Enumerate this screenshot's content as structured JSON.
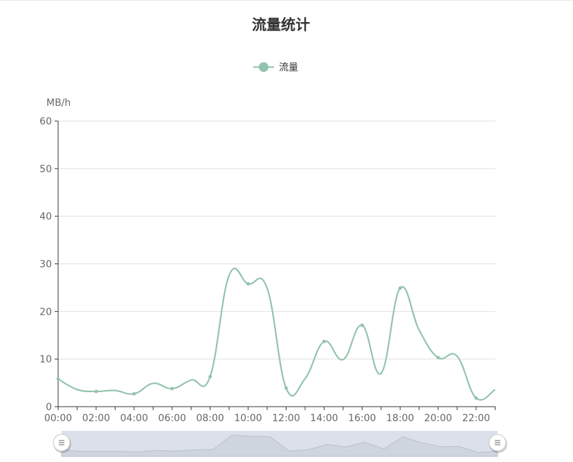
{
  "chart_data": {
    "type": "line",
    "title": "流量统计",
    "ylabel": "MB/h",
    "xlabel": "",
    "legend": {
      "position": "top-center",
      "entries": [
        "流量"
      ]
    },
    "series": [
      {
        "name": "流量",
        "color": "#93c3ac",
        "smooth": true,
        "x": [
          "00:00",
          "01:00",
          "02:00",
          "03:00",
          "04:00",
          "05:00",
          "06:00",
          "07:00",
          "08:00",
          "09:00",
          "10:00",
          "11:00",
          "12:00",
          "13:00",
          "14:00",
          "15:00",
          "16:00",
          "17:00",
          "18:00",
          "19:00",
          "20:00",
          "21:00",
          "22:00",
          "23:00"
        ],
        "values": [
          5.8,
          3.6,
          3.2,
          3.4,
          2.7,
          4.9,
          3.8,
          5.6,
          6.3,
          27.6,
          25.8,
          24.9,
          3.9,
          5.9,
          13.7,
          9.9,
          17.1,
          7.0,
          24.9,
          16.1,
          10.3,
          10.6,
          1.8,
          3.6
        ]
      }
    ],
    "categories": [
      "00:00",
      "01:00",
      "02:00",
      "03:00",
      "04:00",
      "05:00",
      "06:00",
      "07:00",
      "08:00",
      "09:00",
      "10:00",
      "11:00",
      "12:00",
      "13:00",
      "14:00",
      "15:00",
      "16:00",
      "17:00",
      "18:00",
      "19:00",
      "20:00",
      "21:00",
      "22:00",
      "23:00"
    ],
    "x_tick_labels": [
      "00:00",
      "02:00",
      "04:00",
      "06:00",
      "08:00",
      "10:00",
      "12:00",
      "14:00",
      "16:00",
      "18:00",
      "20:00",
      "22:00"
    ],
    "y_ticks": [
      0,
      10,
      20,
      30,
      40,
      50,
      60
    ],
    "ylim": [
      0,
      60
    ],
    "grid": true,
    "data_zoom": {
      "start_percent": 0,
      "end_percent": 100
    },
    "colors": {
      "series": "#93c3ac",
      "grid": "#e0e0e0",
      "axis": "#333333",
      "axis_text": "#666666",
      "zoom_background": "#dbe0ea",
      "zoom_shadow": "#c7cdd6"
    }
  }
}
